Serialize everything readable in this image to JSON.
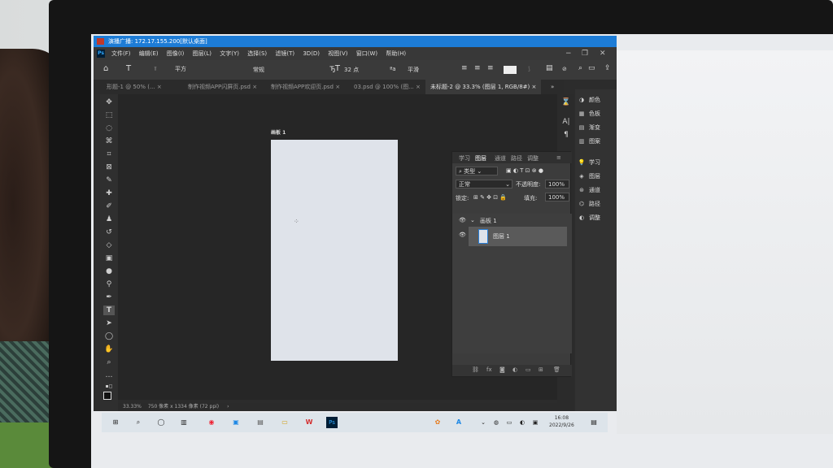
{
  "window": {
    "title": "演播广播: 172.17.155.200[默认桌面]"
  },
  "app_logo": "Ps",
  "menu": [
    "文件(F)",
    "编辑(E)",
    "图像(I)",
    "图层(L)",
    "文字(Y)",
    "选择(S)",
    "滤镜(T)",
    "3D(D)",
    "视图(V)",
    "窗口(W)",
    "帮助(H)"
  ],
  "options": {
    "font_family": "平方",
    "font_style": "常规",
    "font_size": "32 点",
    "aa_mode": "平滑",
    "aa_icon": "ªa"
  },
  "tabs": [
    "形题-1 @ 50% (...",
    "制作视频APP闪屏页.psd",
    "制作视频APP欢迎页.psd",
    "03.psd @ 100% (图...",
    "未标题-2 @ 33.3% (图层 1, RGB/8#)"
  ],
  "tab_overflow": "»",
  "artboard_label": "画板 1",
  "status": {
    "zoom": "33.33%",
    "doc_size": "750 像素 x 1334 像素 (72 ppi)"
  },
  "right_panels": [
    "颜色",
    "色板",
    "渐变",
    "图案",
    "学习",
    "图层",
    "通道",
    "路径",
    "调整"
  ],
  "layers_panel": {
    "tabs": [
      "学习",
      "图层",
      "通道",
      "路径",
      "调整"
    ],
    "filter_kind": "类型",
    "blend_mode": "正常",
    "opacity_label": "不透明度:",
    "opacity_value": "100%",
    "lock_label": "锁定:",
    "fill_label": "填充:",
    "fill_value": "100%",
    "group_name": "画板 1",
    "layer_name": "图层 1",
    "footer_fx": "fx"
  },
  "taskbar": {
    "time": "16:08",
    "date": "2022/9/26"
  },
  "colors": {
    "titlebar": "#1d7cd6",
    "accent": "#2a7fd6",
    "ps_dark": "#2c2c2c"
  }
}
